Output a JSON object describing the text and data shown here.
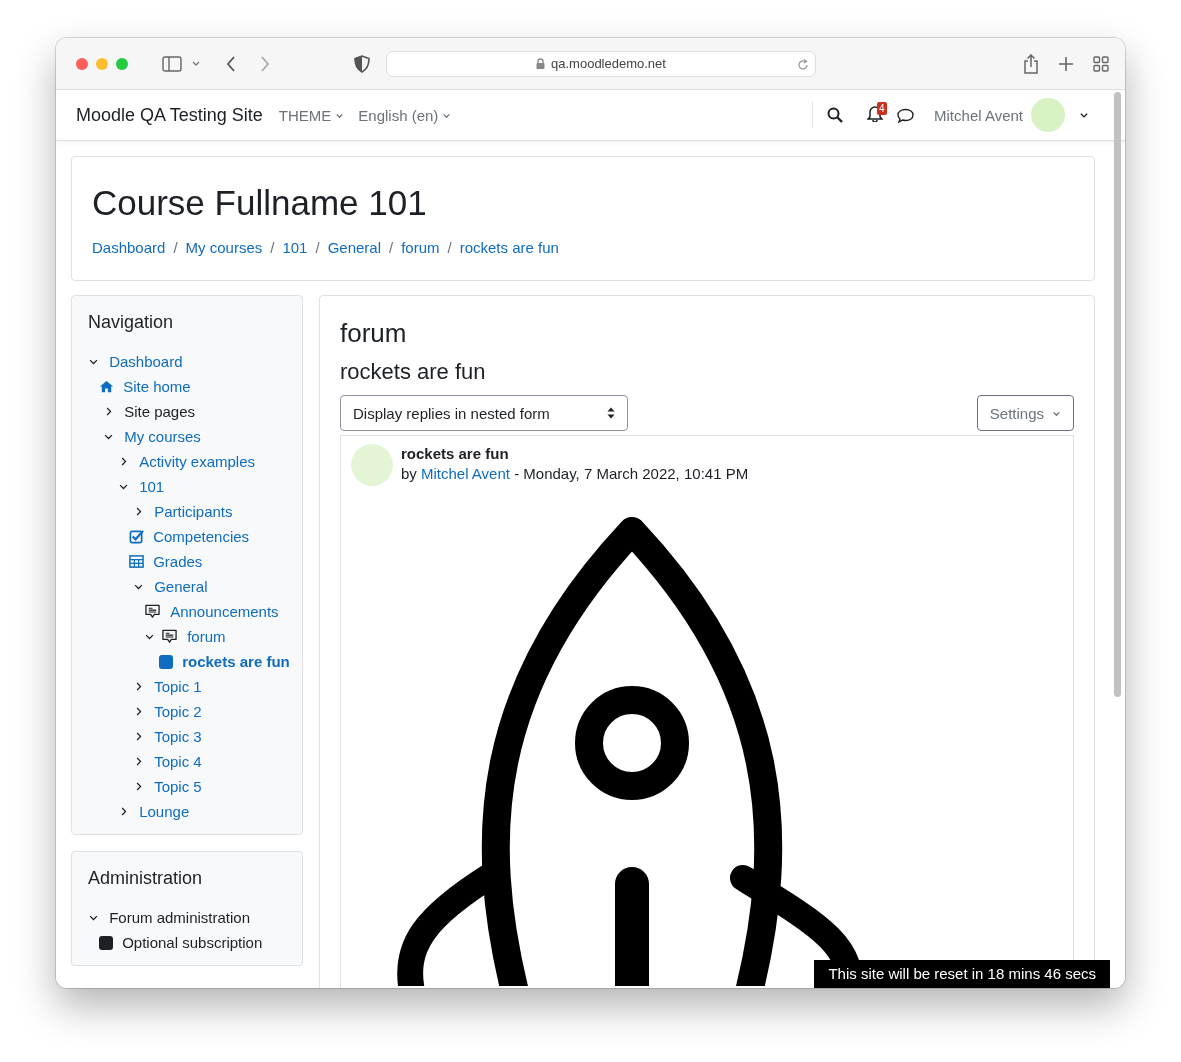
{
  "browser": {
    "url": "qa.moodledemo.net"
  },
  "navbar": {
    "site_name": "Moodle QA Testing Site",
    "menus": [
      "THEME",
      "English (en)"
    ],
    "notification_count": "4",
    "user_name": "Mitchel Avent"
  },
  "header": {
    "title": "Course Fullname 101",
    "separator": "/",
    "breadcrumbs": [
      "Dashboard",
      "My courses",
      "101",
      "General",
      "forum",
      "rockets are fun"
    ]
  },
  "navigation": {
    "title": "Navigation",
    "tree": [
      {
        "label": "Dashboard",
        "kind": "branch",
        "expanded": true,
        "linked": true,
        "selected": false,
        "children": [
          {
            "label": "Site home",
            "kind": "home",
            "linked": true,
            "selected": false
          },
          {
            "label": "Site pages",
            "kind": "branch",
            "expanded": false,
            "linked": false,
            "selected": false
          },
          {
            "label": "My courses",
            "kind": "branch",
            "expanded": true,
            "linked": true,
            "selected": false,
            "children": [
              {
                "label": "Activity examples",
                "kind": "branch",
                "expanded": false,
                "linked": true,
                "selected": false
              },
              {
                "label": "101",
                "kind": "branch",
                "expanded": true,
                "linked": true,
                "selected": false,
                "children": [
                  {
                    "label": "Participants",
                    "kind": "branch",
                    "expanded": false,
                    "linked": true,
                    "selected": false
                  },
                  {
                    "label": "Competencies",
                    "kind": "checkbox",
                    "linked": true,
                    "selected": false
                  },
                  {
                    "label": "Grades",
                    "kind": "table",
                    "linked": true,
                    "selected": false
                  },
                  {
                    "label": "General",
                    "kind": "branch",
                    "expanded": true,
                    "linked": true,
                    "selected": false,
                    "children": [
                      {
                        "label": "Announcements",
                        "kind": "forum",
                        "linked": true,
                        "selected": false
                      },
                      {
                        "label": "forum",
                        "kind": "forum-branch",
                        "expanded": true,
                        "linked": true,
                        "selected": false,
                        "children": [
                          {
                            "label": "rockets are fun",
                            "kind": "square",
                            "linked": true,
                            "selected": true
                          }
                        ]
                      }
                    ]
                  },
                  {
                    "label": "Topic 1",
                    "kind": "branch",
                    "expanded": false,
                    "linked": true,
                    "selected": false
                  },
                  {
                    "label": "Topic 2",
                    "kind": "branch",
                    "expanded": false,
                    "linked": true,
                    "selected": false
                  },
                  {
                    "label": "Topic 3",
                    "kind": "branch",
                    "expanded": false,
                    "linked": true,
                    "selected": false
                  },
                  {
                    "label": "Topic 4",
                    "kind": "branch",
                    "expanded": false,
                    "linked": true,
                    "selected": false
                  },
                  {
                    "label": "Topic 5",
                    "kind": "branch",
                    "expanded": false,
                    "linked": true,
                    "selected": false
                  }
                ]
              },
              {
                "label": "Lounge",
                "kind": "branch",
                "expanded": false,
                "linked": true,
                "selected": false
              }
            ]
          }
        ]
      }
    ]
  },
  "administration": {
    "title": "Administration",
    "tree": [
      {
        "label": "Forum administration",
        "kind": "branch",
        "expanded": true,
        "linked": false,
        "selected": false,
        "children": [
          {
            "label": "Optional subscription",
            "kind": "square",
            "linked": false,
            "selected": false
          }
        ]
      }
    ]
  },
  "main": {
    "activity": "forum",
    "discussion": "rockets are fun",
    "display_mode": "Display replies in nested form",
    "settings": "Settings",
    "post": {
      "subject": "rockets are fun",
      "by": "by",
      "author": "Mitchel Avent",
      "date": "- Monday, 7 March 2022, 10:41 PM"
    }
  },
  "reset_notice": "This site will be reset in 18 mins 46 secs"
}
